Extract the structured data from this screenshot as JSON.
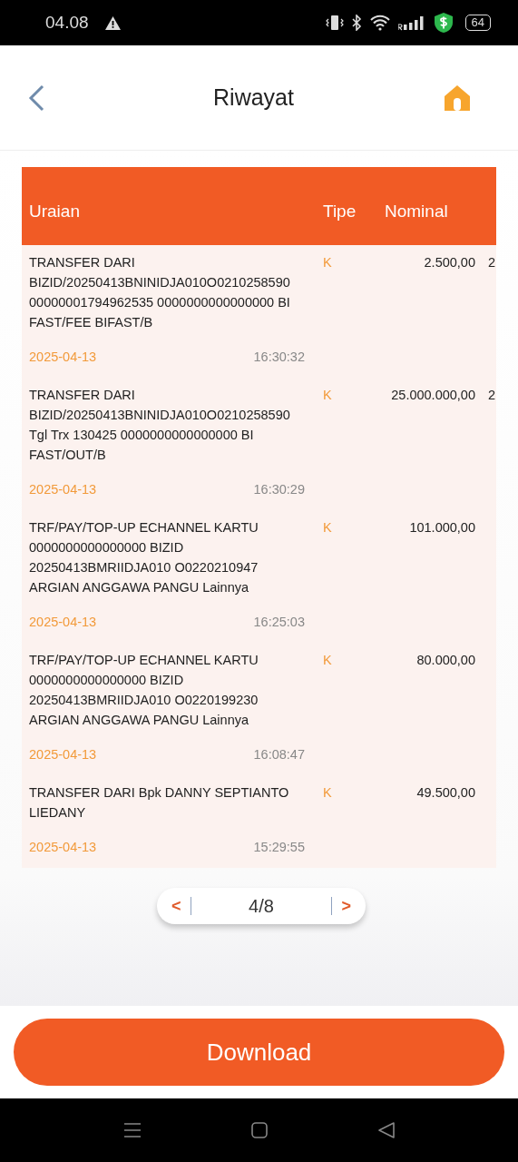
{
  "status_bar": {
    "time": "04.08",
    "battery": "64"
  },
  "header": {
    "title": "Riwayat"
  },
  "table": {
    "columns": [
      "Uraian",
      "Tipe",
      "Nominal"
    ],
    "rows": [
      {
        "description": "TRANSFER DARI BIZID/20250413BNINIDJA010O0210258590 00000001794962535 0000000000000000 BI FAST/FEE BIFAST/B",
        "date": "2025-04-13",
        "time": "16:30:32",
        "type": "K",
        "amount": "2.500,00",
        "column_4": "2"
      },
      {
        "description": "TRANSFER DARI BIZID/20250413BNINIDJA010O0210258590 Tgl Trx 130425 0000000000000000 BI FAST/OUT/B",
        "date": "2025-04-13",
        "time": "16:30:29",
        "type": "K",
        "amount": "25.000.000,00",
        "column_4": "2"
      },
      {
        "description": "TRF/PAY/TOP-UP ECHANNEL KARTU 0000000000000000 BIZID 20250413BMRIIDJA010 O0220210947 ARGIAN ANGGAWA PANGU Lainnya",
        "date": "2025-04-13",
        "time": "16:25:03",
        "type": "K",
        "amount": "101.000,00"
      },
      {
        "description": "TRF/PAY/TOP-UP ECHANNEL KARTU 0000000000000000 BIZID 20250413BMRIIDJA010 O0220199230 ARGIAN ANGGAWA PANGU Lainnya",
        "date": "2025-04-13",
        "time": "16:08:47",
        "type": "K",
        "amount": "80.000,00"
      },
      {
        "description": "TRANSFER DARI Bpk DANNY SEPTIANTO LIEDANY",
        "date": "2025-04-13",
        "time": "15:29:55",
        "type": "K",
        "amount": "49.500,00"
      }
    ]
  },
  "pagination": {
    "prev": "<",
    "page": "4/8",
    "next": ">"
  },
  "download_button": "Download"
}
